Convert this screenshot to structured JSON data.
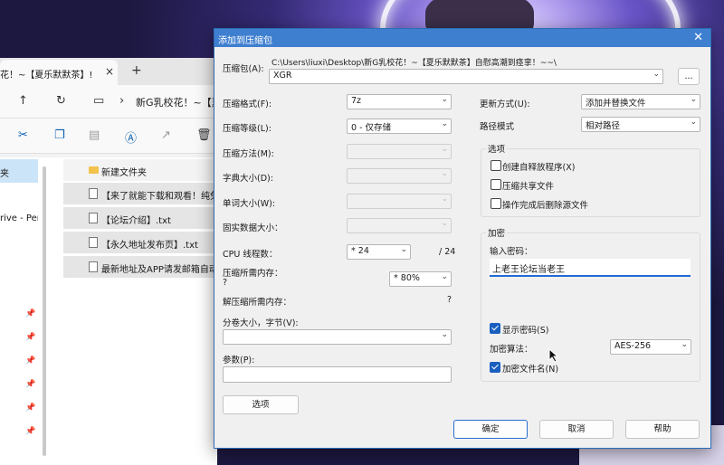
{
  "explorer": {
    "tab_title": "花！~【夏乐默默茶】!",
    "tab_close": "×",
    "new_tab": "+",
    "path": "新G乳校花！~【夏",
    "sidebar": [
      {
        "label": "夹",
        "selected": true
      },
      {
        "label": "rive - Per",
        "selected": false
      }
    ],
    "files": [
      {
        "name": "新建文件夹",
        "type": "folder"
      },
      {
        "name": "【来了就能下载和观看！纯免",
        "type": "doc"
      },
      {
        "name": "【论坛介绍】.txt",
        "type": "doc"
      },
      {
        "name": "【永久地址发布页】.txt",
        "type": "doc"
      },
      {
        "name": "最新地址及APP请发邮箱自动",
        "type": "doc"
      }
    ]
  },
  "dialog": {
    "title": "添加到压缩包",
    "close": "✕",
    "archive_label": "压缩包(A):",
    "archive_path": "C:\\Users\\liuxi\\Desktop\\新G乳校花！~【夏乐默默茶】自慰高潮到痉挛！~~\\",
    "archive_name": "XGR",
    "browse_label": "...",
    "left": {
      "format": {
        "label": "压缩格式(F):",
        "value": "7z"
      },
      "level": {
        "label": "压缩等级(L):",
        "value": "0 - 仅存储"
      },
      "method": {
        "label": "压缩方法(M):",
        "value": ""
      },
      "dict": {
        "label": "字典大小(D):",
        "value": ""
      },
      "word": {
        "label": "单词大小(W):",
        "value": ""
      },
      "solid": {
        "label": "固实数据大小：",
        "value": ""
      },
      "cpu": {
        "label": "CPU 线程数：",
        "value": "* 24",
        "max": "/ 24"
      },
      "mem_compress": {
        "label": "压缩所需内存：",
        "sub": "?",
        "value": "* 80%"
      },
      "mem_decompress": {
        "label": "解压缩所需内存：",
        "value": "?"
      },
      "split": {
        "label": "分卷大小，字节(V):",
        "value": ""
      },
      "params": {
        "label": "参数(P):",
        "value": ""
      },
      "options_button": "选项"
    },
    "right": {
      "update": {
        "label": "更新方式(U):",
        "value": "添加并替换文件"
      },
      "pathmode": {
        "label": "路径模式",
        "value": "相对路径"
      },
      "options_group": "选项",
      "opt_sfx": {
        "label": "创建自释放程序(X)",
        "checked": false
      },
      "opt_shared": {
        "label": "压缩共享文件",
        "checked": false
      },
      "opt_delete": {
        "label": "操作完成后删除源文件",
        "checked": false
      },
      "encrypt_group": "加密",
      "password_label": "输入密码：",
      "password_value": "上老王论坛当老王",
      "show_password": {
        "label": "显示密码(S)",
        "checked": true
      },
      "enc_method": {
        "label": "加密算法：",
        "value": "AES-256"
      },
      "encrypt_names": {
        "label": "加密文件名(N)",
        "checked": true
      }
    },
    "ok_button": "确定",
    "cancel_button": "取消",
    "help_button": "帮助"
  }
}
